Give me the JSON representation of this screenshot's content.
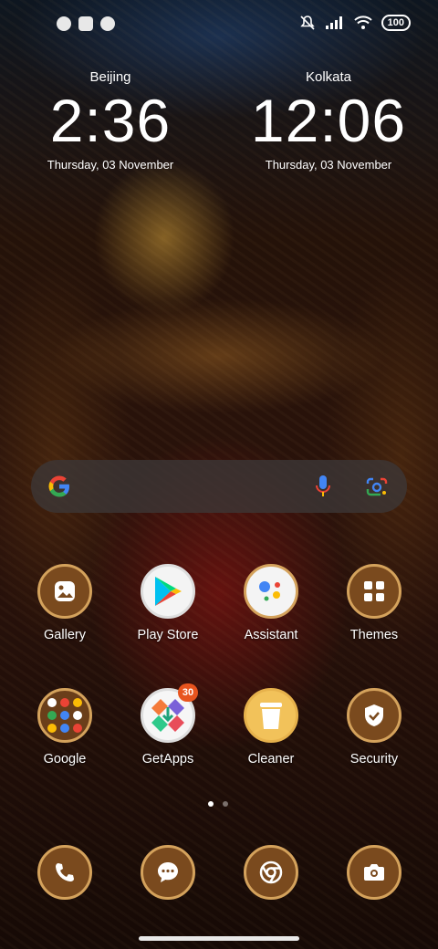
{
  "status_bar": {
    "left_icons": [
      "app-icon-1",
      "square-icon",
      "app-icon-2"
    ],
    "right_icons": [
      "mute-icon",
      "signal-icon",
      "wifi-icon"
    ],
    "battery": "100"
  },
  "clocks": [
    {
      "city": "Beijing",
      "time": "2:36",
      "date": "Thursday, 03 November"
    },
    {
      "city": "Kolkata",
      "time": "12:06",
      "date": "Thursday, 03 November"
    }
  ],
  "search": {
    "icons": [
      "google-g-icon",
      "mic-icon",
      "lens-icon"
    ]
  },
  "apps": [
    {
      "label": "Gallery",
      "icon": "gallery-icon"
    },
    {
      "label": "Play Store",
      "icon": "play-store-icon"
    },
    {
      "label": "Assistant",
      "icon": "assistant-icon"
    },
    {
      "label": "Themes",
      "icon": "themes-icon"
    },
    {
      "label": "Google",
      "icon": "google-folder-icon"
    },
    {
      "label": "GetApps",
      "icon": "getapps-icon",
      "badge": "30"
    },
    {
      "label": "Cleaner",
      "icon": "cleaner-icon"
    },
    {
      "label": "Security",
      "icon": "security-icon"
    }
  ],
  "page_indicator": {
    "pages": 2,
    "current": 1
  },
  "dock": [
    {
      "icon": "phone-icon"
    },
    {
      "icon": "messaging-icon"
    },
    {
      "icon": "chrome-icon"
    },
    {
      "icon": "camera-icon"
    }
  ],
  "colors": {
    "icon_bg": "#7a4a1e",
    "icon_ring": "#d4a25c",
    "badge": "#e8541e"
  }
}
